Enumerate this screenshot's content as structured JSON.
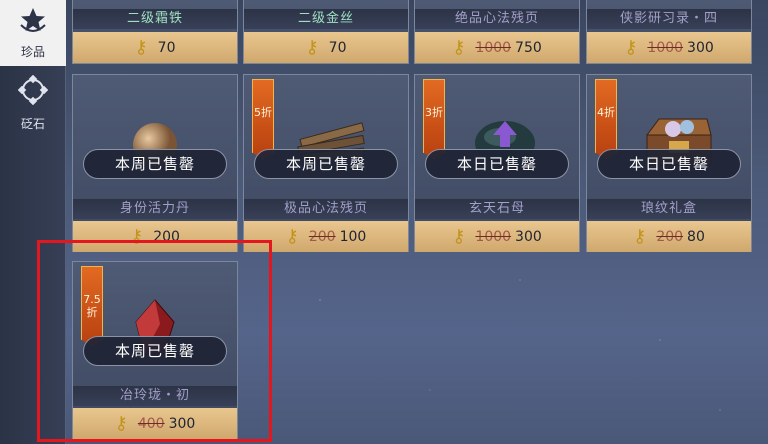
{
  "sidebar": {
    "tabs": [
      {
        "label": "珍品",
        "icon": "star-badge-icon"
      },
      {
        "label": "砭石",
        "icon": "stone-ring-icon"
      }
    ]
  },
  "cards": [
    {
      "name": "二级霜铁",
      "price": "70",
      "old_price": null
    },
    {
      "name": "二级金丝",
      "price": "70",
      "old_price": null
    },
    {
      "name": "绝品心法残页",
      "price": "750",
      "old_price": "1000"
    },
    {
      "name": "侠影研习录・四",
      "price": "300",
      "old_price": "1000"
    },
    {
      "name": "身份活力丹",
      "price": "200",
      "old_price": null,
      "status": "本周已售罄"
    },
    {
      "name": "极品心法残页",
      "price": "100",
      "old_price": "200",
      "status": "本周已售罄",
      "discount": "5折"
    },
    {
      "name": "玄天石母",
      "price": "300",
      "old_price": "1000",
      "status": "本日已售罄",
      "discount": "3折"
    },
    {
      "name": "琅纹礼盒",
      "price": "80",
      "old_price": "200",
      "status": "本日已售罄",
      "discount": "4折"
    },
    {
      "name": "冶玲珑・初",
      "price": "300",
      "old_price": "400",
      "status": "本周已售罄",
      "discount": "7.5折"
    }
  ]
}
